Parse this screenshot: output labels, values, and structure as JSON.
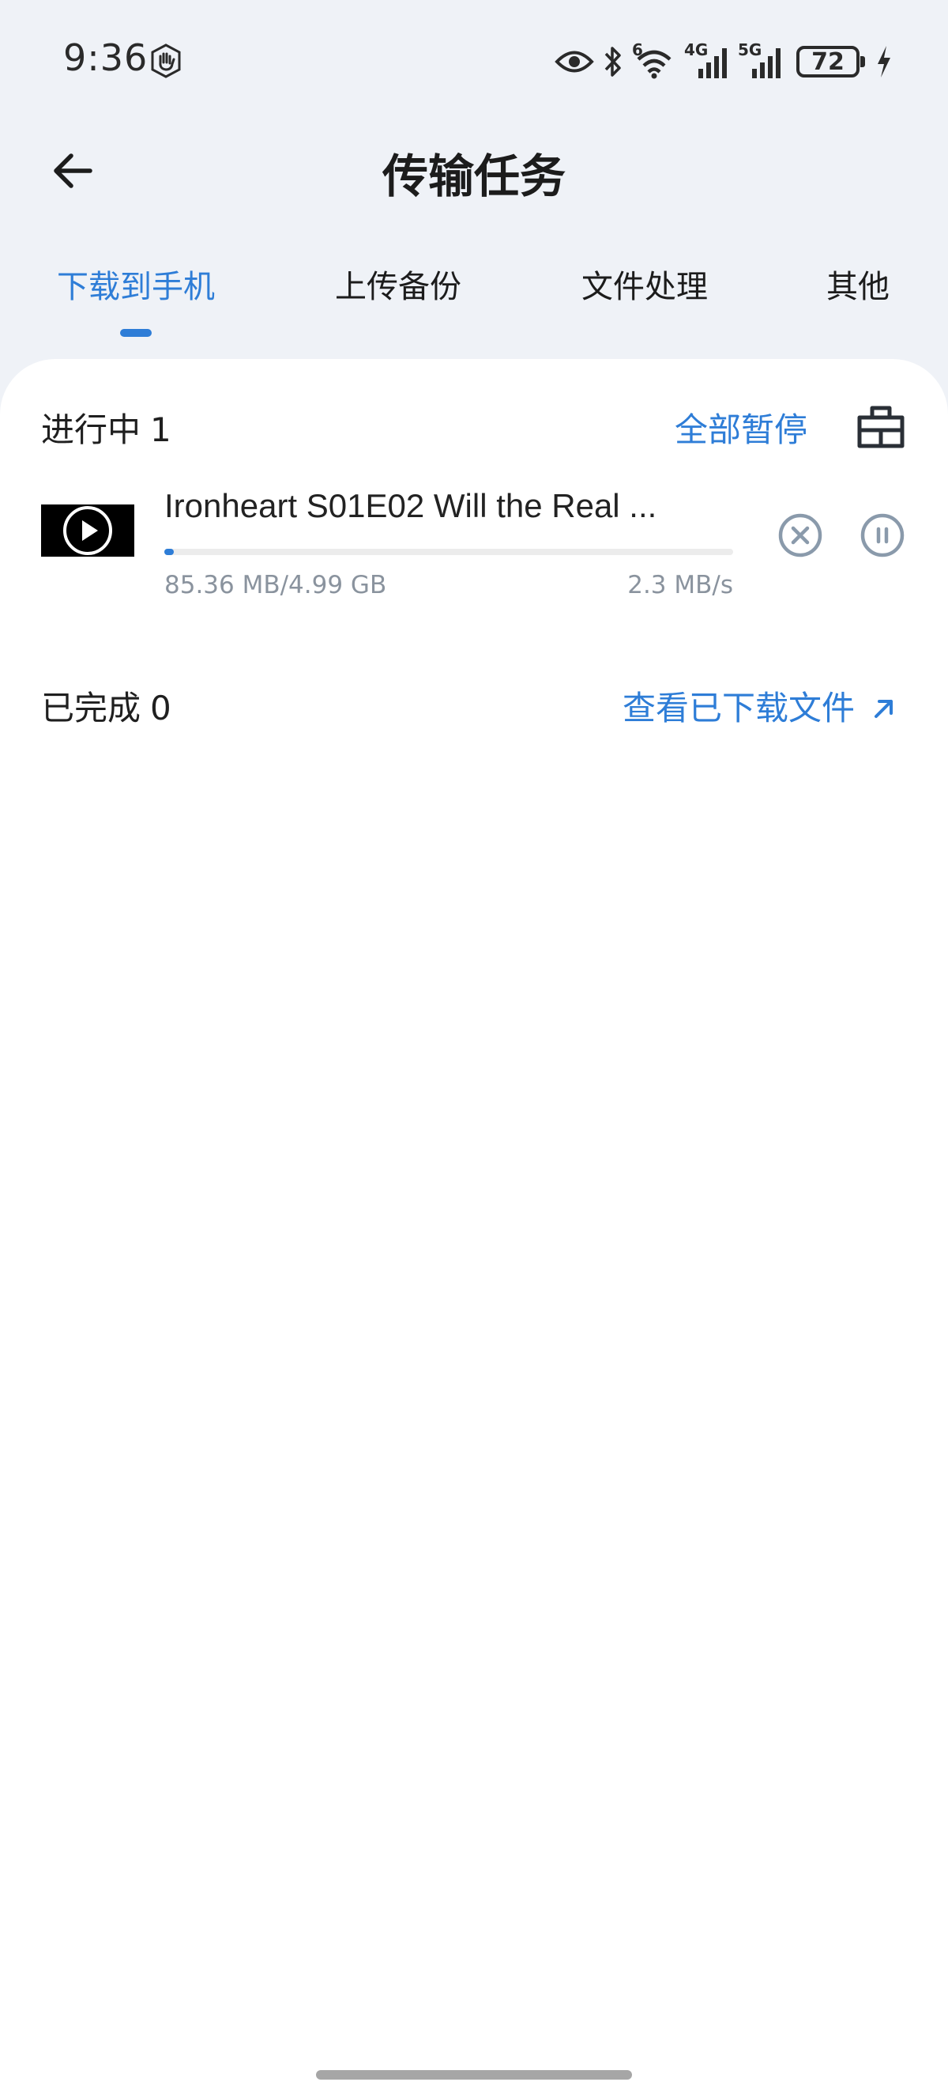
{
  "status_bar": {
    "time": "9:36",
    "network_labels": [
      "6",
      "4G",
      "5G"
    ],
    "battery": "72",
    "icons": [
      "hand-icon",
      "eye-icon",
      "bluetooth-icon",
      "wifi-icon",
      "signal-icon",
      "charging-icon"
    ]
  },
  "header": {
    "title": "传输任务"
  },
  "tabs": [
    {
      "label": "下载到手机",
      "active": true
    },
    {
      "label": "上传备份",
      "active": false
    },
    {
      "label": "文件处理",
      "active": false
    },
    {
      "label": "其他",
      "active": false
    }
  ],
  "in_progress": {
    "title": "进行中",
    "count": "1",
    "pause_all_label": "全部暂停",
    "items": [
      {
        "name": "Ironheart S01E02 Will the Real ...",
        "progress_fraction": 0.017,
        "size_text": "85.36 MB/4.99 GB",
        "speed_text": "2.3 MB/s"
      }
    ]
  },
  "completed": {
    "title": "已完成",
    "count": "0",
    "view_link_label": "查看已下载文件"
  },
  "colors": {
    "accent": "#2e7dd7",
    "background": "#eff2f7",
    "card": "#ffffff",
    "muted_text": "#8a939e",
    "icon_gray": "#8a9aab"
  }
}
